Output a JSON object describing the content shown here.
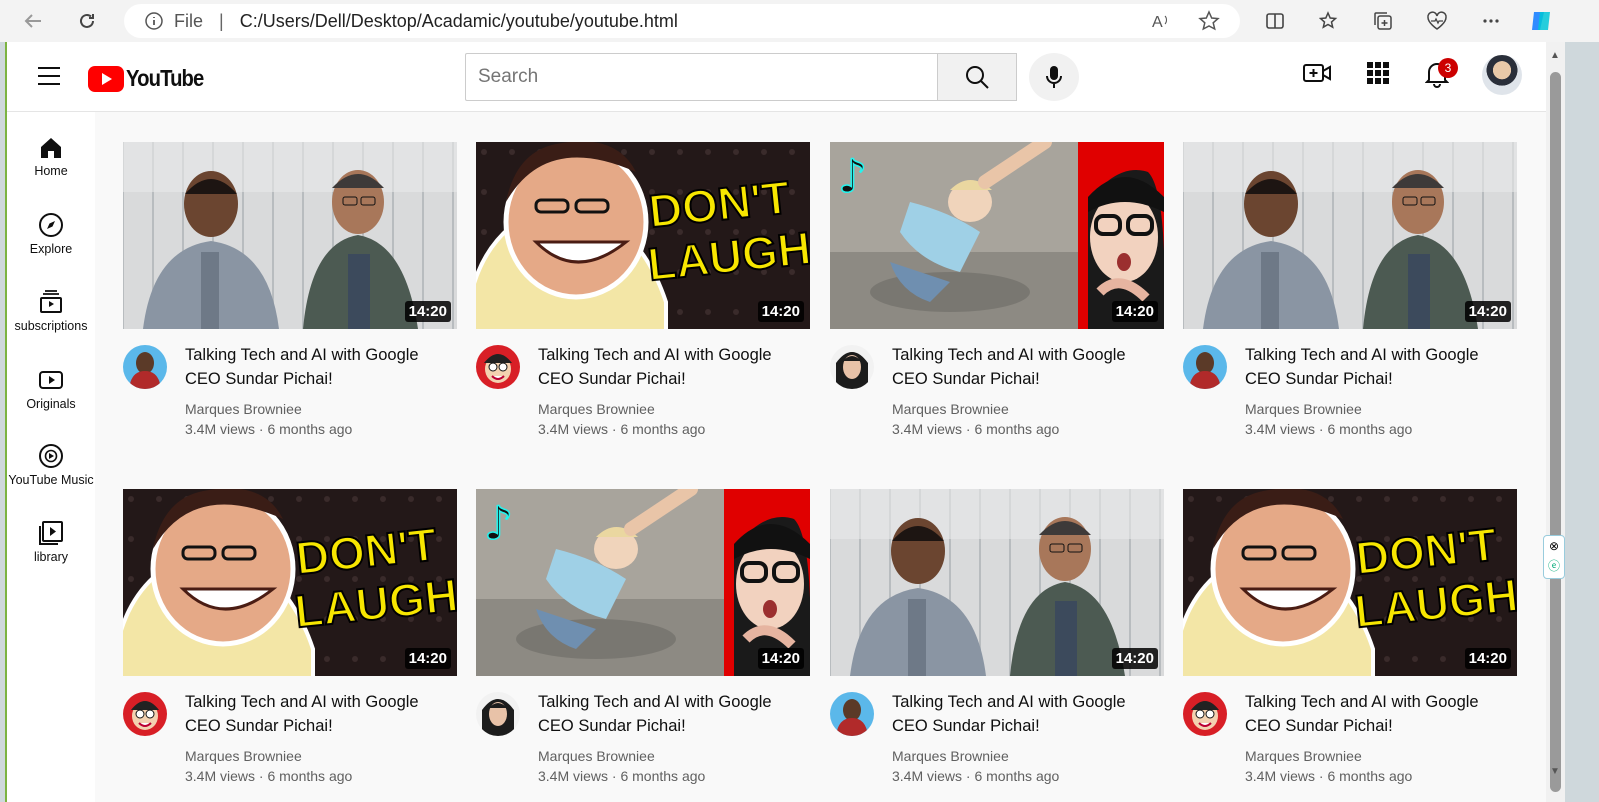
{
  "browser": {
    "file_label": "File",
    "url": "C:/Users/Dell/Desktop/Acadamic/youtube/youtube.html"
  },
  "header": {
    "logo_text": "YouTube",
    "search_placeholder": "Search",
    "notification_count": "3"
  },
  "sidebar": {
    "items": [
      {
        "label": "Home",
        "icon": "home-icon"
      },
      {
        "label": "Explore",
        "icon": "compass-icon"
      },
      {
        "label": "subscriptions",
        "icon": "subscriptions-icon"
      },
      {
        "label": "Originals",
        "icon": "play-box-icon"
      },
      {
        "label": "YouTube Music",
        "icon": "music-icon"
      },
      {
        "label": "library",
        "icon": "library-icon"
      }
    ]
  },
  "videos": [
    {
      "title": "Talking Tech and AI with Google CEO Sundar Pichai!",
      "channel": "Marques Browniee",
      "meta": "3.4M views · 6 months ago",
      "duration": "14:20",
      "thumb": "two-men",
      "avatar": "mkbhd"
    },
    {
      "title": "Talking Tech and AI with Google CEO Sundar Pichai!",
      "channel": "Marques Browniee",
      "meta": "3.4M views · 6 months ago",
      "duration": "14:20",
      "thumb": "dont-laugh",
      "avatar": "cartoon"
    },
    {
      "title": "Talking Tech and AI with Google CEO Sundar Pichai!",
      "channel": "Marques Browniee",
      "meta": "3.4M views · 6 months ago",
      "duration": "14:20",
      "thumb": "tiktok",
      "avatar": "woman"
    },
    {
      "title": "Talking Tech and AI with Google CEO Sundar Pichai!",
      "channel": "Marques Browniee",
      "meta": "3.4M views · 6 months ago",
      "duration": "14:20",
      "thumb": "two-men",
      "avatar": "mkbhd"
    },
    {
      "title": "Talking Tech and AI with Google CEO Sundar Pichai!",
      "channel": "Marques Browniee",
      "meta": "3.4M views · 6 months ago",
      "duration": "14:20",
      "thumb": "dont-laugh",
      "avatar": "cartoon"
    },
    {
      "title": "Talking Tech and AI with Google CEO Sundar Pichai!",
      "channel": "Marques Browniee",
      "meta": "3.4M views · 6 months ago",
      "duration": "14:20",
      "thumb": "tiktok",
      "avatar": "woman"
    },
    {
      "title": "Talking Tech and AI with Google CEO Sundar Pichai!",
      "channel": "Marques Browniee",
      "meta": "3.4M views · 6 months ago",
      "duration": "14:20",
      "thumb": "two-men",
      "avatar": "mkbhd"
    },
    {
      "title": "Talking Tech and AI with Google CEO Sundar Pichai!",
      "channel": "Marques Browniee",
      "meta": "3.4M views · 6 months ago",
      "duration": "14:20",
      "thumb": "dont-laugh",
      "avatar": "cartoon"
    }
  ],
  "thumb_text": {
    "dont_laugh_line1": "DON'T",
    "dont_laugh_line2": "LAUGH"
  },
  "colors": {
    "brand_red": "#ff0000",
    "badge_red": "#cc0000",
    "thumb_yellow": "#f7e600"
  }
}
